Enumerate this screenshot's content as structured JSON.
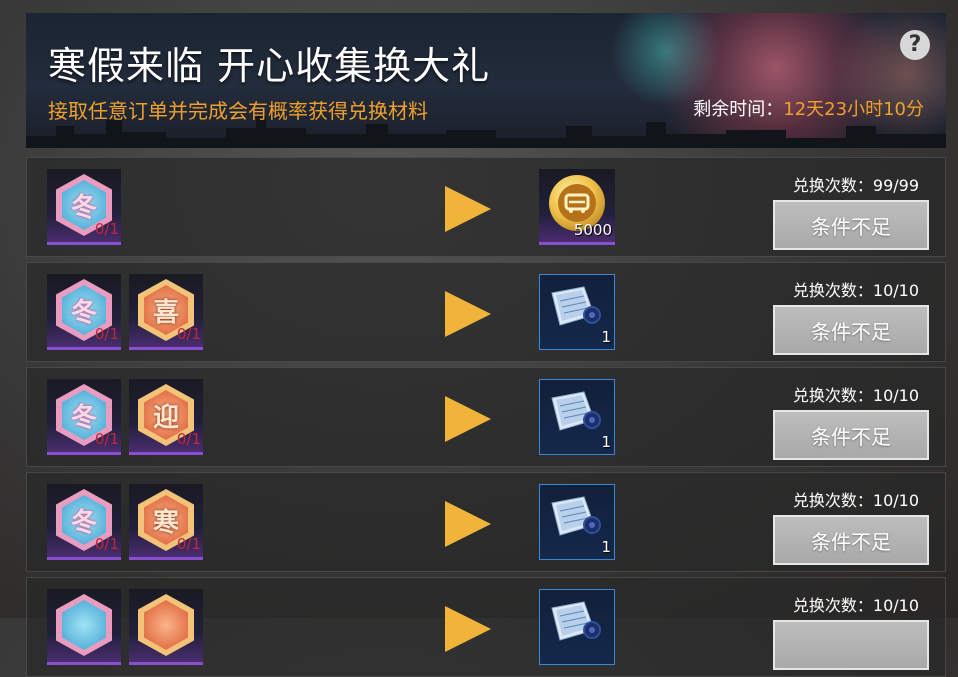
{
  "banner": {
    "title": "寒假来临  开心收集换大礼",
    "subtitle": "接取任意订单并完成会有概率获得兑换材料",
    "time_label": "剩余时间：",
    "time_value": "12天23小时10分",
    "help_label": "?"
  },
  "colors": {
    "accent_orange": "#f0a12c",
    "button_gray": "#b3b3b3",
    "arrow_gold": "#f1b43a",
    "count_red": "#c0283a"
  },
  "rows": [
    {
      "materials": [
        {
          "char": "冬",
          "style": "blue",
          "count": "0/1",
          "icon": "winter-token-icon"
        }
      ],
      "reward": {
        "type": "coin",
        "qty": "5000",
        "icon": "gold-coin-icon"
      },
      "times_label": "兑换次数：",
      "times_value": "99/99",
      "button_label": "条件不足"
    },
    {
      "materials": [
        {
          "char": "冬",
          "style": "blue",
          "count": "0/1",
          "icon": "winter-token-icon"
        },
        {
          "char": "喜",
          "style": "orange",
          "count": "0/1",
          "icon": "joy-token-icon"
        }
      ],
      "reward": {
        "type": "blueprint",
        "qty": "1",
        "icon": "blueprint-icon"
      },
      "times_label": "兑换次数：",
      "times_value": "10/10",
      "button_label": "条件不足"
    },
    {
      "materials": [
        {
          "char": "冬",
          "style": "blue",
          "count": "0/1",
          "icon": "winter-token-icon"
        },
        {
          "char": "迎",
          "style": "orange",
          "count": "0/1",
          "icon": "welcome-token-icon"
        }
      ],
      "reward": {
        "type": "blueprint",
        "qty": "1",
        "icon": "blueprint-icon"
      },
      "times_label": "兑换次数：",
      "times_value": "10/10",
      "button_label": "条件不足"
    },
    {
      "materials": [
        {
          "char": "冬",
          "style": "blue",
          "count": "0/1",
          "icon": "winter-token-icon"
        },
        {
          "char": "寒",
          "style": "orange",
          "count": "0/1",
          "icon": "cold-token-icon"
        }
      ],
      "reward": {
        "type": "blueprint",
        "qty": "1",
        "icon": "blueprint-icon"
      },
      "times_label": "兑换次数：",
      "times_value": "10/10",
      "button_label": "条件不足"
    },
    {
      "materials": [
        {
          "char": "",
          "style": "blue",
          "count": "",
          "icon": "winter-token-icon"
        },
        {
          "char": "",
          "style": "orange",
          "count": "",
          "icon": "joy-token-icon"
        }
      ],
      "reward": {
        "type": "blueprint",
        "qty": "",
        "icon": "blueprint-icon"
      },
      "times_label": "兑换次数：",
      "times_value": "10/10",
      "button_label": ""
    }
  ]
}
